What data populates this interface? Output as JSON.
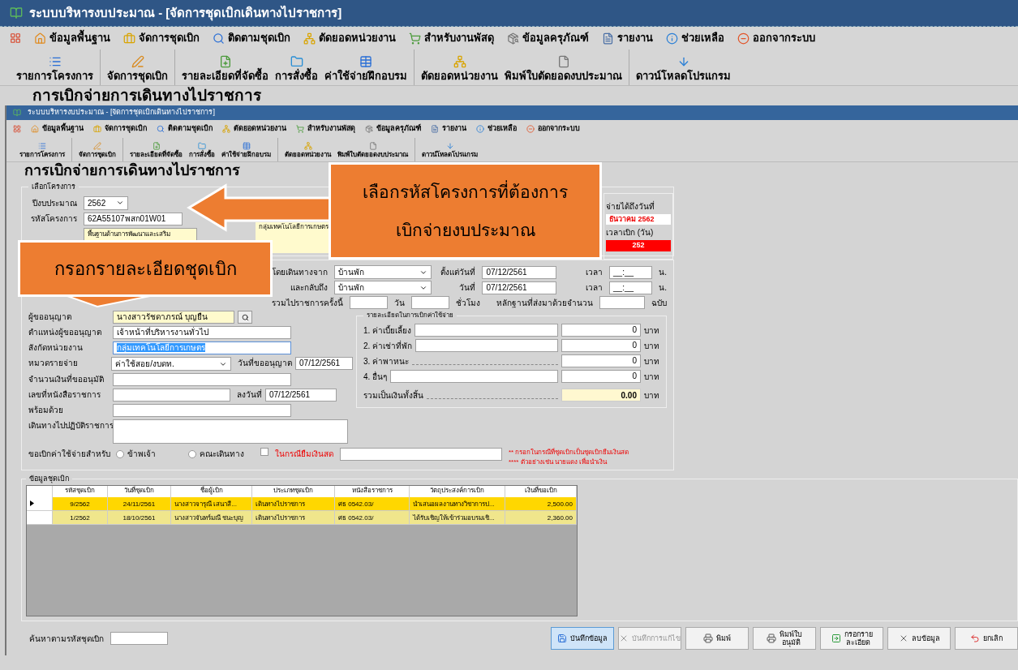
{
  "window": {
    "title": "ระบบบริหารงบประมาณ - [จัดการชุดเบิกเดินทางไปราชการ]"
  },
  "menu": [
    "ข้อมูลพื้นฐาน",
    "จัดการชุดเบิก",
    "ติดตามชุดเบิก",
    "ตัดยอดหน่วยงาน",
    "สำหรับงานพัสดุ",
    "ข้อมูลครุภัณฑ์",
    "รายงาน",
    "ช่วยเหลือ",
    "ออกจากระบบ"
  ],
  "toolbar_groups": [
    {
      "items": [
        "รายการโครงการ"
      ]
    },
    {
      "items": [
        "จัดการชุดเบิก"
      ]
    },
    {
      "items": [
        "รายละเอียดที่จัดซื้อ",
        "การสั่งซื้อ",
        "ค่าใช้จ่ายฝึกอบรม"
      ]
    },
    {
      "items": [
        "ตัดยอดหน่วยงาน",
        "พิมพ์ใบตัดยอดงบประมาณ"
      ]
    },
    {
      "items": [
        "ดาวน์โหลดโปรแกรม"
      ]
    }
  ],
  "page_heading": "การเบิกจ่ายการเดินทางไปราชการ",
  "inner_window": {
    "title": "ระบบบริหารงบประมาณ - [จัดการชุดเบิกเดินทางไปราชการ]",
    "menu": [
      "ข้อมูลพื้นฐาน",
      "จัดการชุดเบิก",
      "ติดตามชุดเบิก",
      "ตัดยอดหน่วยงาน",
      "สำหรับงานพัสดุ",
      "ข้อมูลครุภัณฑ์",
      "รายงาน",
      "ช่วยเหลือ",
      "ออกจากระบบ"
    ],
    "toolbar_groups": [
      {
        "items": [
          "รายการโครงการ"
        ]
      },
      {
        "items": [
          "จัดการชุดเบิก"
        ]
      },
      {
        "items": [
          "รายละเอียดที่จัดซื้อ",
          "การสั่งซื้อ",
          "ค่าใช้จ่ายฝึกอบรม"
        ]
      },
      {
        "items": [
          "ตัดยอดหน่วยงาน",
          "พิมพ์ใบตัดยอดงบประมาณ"
        ]
      },
      {
        "items": [
          "ดาวน์โหลดโปรแกรม"
        ]
      }
    ]
  },
  "form": {
    "heading": "การเบิกจ่ายการเดินทางไปราชการ",
    "project": {
      "legend": "เลือกโครงการ",
      "fiscal_year_label": "ปีงบประมาณ",
      "fiscal_year": "2562",
      "code_label": "รหัสโครงการ",
      "code": "62A55107พสก01W01",
      "output_text": "พื้นฐานด้านการพัฒนาและเสริม",
      "department_note": "กลุ่มเทคโนโลยีการเกษตร",
      "deadline_label": "จ่ายได้ถึงวันที่",
      "deadline": "ธันวาคม 2562",
      "days_label": "เวลาเบิก (วัน)",
      "days": "252"
    },
    "travel": {
      "from_label": "โดยเดินทางจาก",
      "from": "บ้านพัก",
      "start_label": "ตั้งแต่วันที่",
      "start_date": "07/12/2561",
      "start_time_label": "เวลา",
      "start_time": "__:__",
      "start_unit": "น.",
      "return_label": "และกลับถึง",
      "return": "บ้านพัก",
      "return_date_label": "วันที่",
      "return_date": "07/12/2561",
      "return_time_label": "เวลา",
      "return_time": "__:__",
      "return_unit": "น.",
      "total_label": "รวมไปราชการครั้งนี้",
      "days_unit": "วัน",
      "hours_unit": "ชั่วโมง",
      "evidence_label": "หลักฐานที่ส่งมาด้วยจำนวน",
      "evidence_unit": "ฉบับ"
    },
    "fields": [
      {
        "label": "ผู้ขออนุญาต",
        "kind": "lookup",
        "value": "นางสาวรัชดาภรณ์ บุญยืน"
      },
      {
        "label": "ตำแหน่งผู้ขออนุญาต",
        "kind": "text",
        "value": "เจ้าหน้าที่บริหารงานทั่วไป"
      },
      {
        "label": "สังกัดหน่วยงาน",
        "kind": "highlighted",
        "value": "กลุ่มเทคโนโลยีการเกษตร"
      },
      {
        "label": "หมวดรายจ่าย",
        "kind": "select",
        "value": "ค่าใช้สอย/งบดท.",
        "side_label": "วันที่ขออนุญาต",
        "side_value": "07/12/2561"
      },
      {
        "label": "จำนวนเงินที่ขออนุมัติ",
        "kind": "text"
      },
      {
        "label": "เลขที่หนังสือราชการ",
        "kind": "short",
        "side_label": "ลงวันที่",
        "side_value": "07/12/2561"
      },
      {
        "label": "พร้อมด้วย",
        "kind": "text"
      },
      {
        "label": "เดินทางไปปฏิบัติราชการ",
        "kind": "textarea"
      }
    ],
    "claim": {
      "label": "ขอเบิกค่าใช้จ่ายสำหรับ",
      "options": [
        {
          "label": "ข้าพเจ้า",
          "selected": false
        },
        {
          "label": "คณะเดินทาง",
          "selected": false
        }
      ],
      "cash_advance": {
        "label": "ในกรณียืมเงินสด",
        "checked": false
      },
      "notes": [
        "** กรอกในกรณีที่ชุดเบิกเป็นชุดเบิกยืมเงินสด",
        "**** ตัวอย่างเช่น นายแดง เพื่อนำเงิน"
      ]
    },
    "expenses": {
      "legend": "รายละเอียดในการเบิกค่าใช้จ่าย",
      "items": [
        {
          "label": "1. ค่าเบี้ยเลี้ยง",
          "kind": "field",
          "amount": "0",
          "unit": "บาท"
        },
        {
          "label": "2. ค่าเช่าที่พัก",
          "kind": "field",
          "amount": "0",
          "unit": "บาท"
        },
        {
          "label": "3. ค่าพาหนะ",
          "kind": "dotted",
          "amount": "0",
          "unit": "บาท"
        },
        {
          "label": "4. อื่นๆ",
          "kind": "field",
          "amount": "0",
          "unit": "บาท"
        }
      ],
      "total_label": "รวมเป็นเงินทั้งสิ้น",
      "total": "0.00",
      "total_unit": "บาท"
    }
  },
  "grid": {
    "legend": "ข้อมูลชุดเบิก",
    "columns": [
      "รหัสชุดเบิก",
      "วันที่ชุดเบิก",
      "ชื่อผู้เบิก",
      "ประเภทชุดเบิก",
      "หนังสือราชการ",
      "วัตถุประสงค์การเบิก",
      "เงินที่ขอเบิก"
    ],
    "rows": [
      {
        "selected": true,
        "color": "#ffd700",
        "cells": [
          "9/2562",
          "24/11/2561",
          "นางสาวจารุณี เสนาสี...",
          "เดินทางไปราชการ",
          "ศธ 0542.03/",
          "นำเสนอผลงานทางวิชาการป...",
          "2,500.00"
        ]
      },
      {
        "selected": false,
        "color": "#f0e68c",
        "cells": [
          "1/2562",
          "18/10/2561",
          "นางสาวจันทร์มณี ชนะบุญ",
          "เดินทางไปราชการ",
          "ศธ 0542.03/",
          "ได้รับเชิญให้เข้าร่วมอบรมเชิ...",
          "2,360.00"
        ]
      }
    ]
  },
  "bottom": {
    "search_label": "ค้นหาตามรหัสชุดเบิก",
    "buttons": [
      {
        "lines": [
          "บันทึกข้อมูล"
        ],
        "selected": true,
        "disabled": false
      },
      {
        "lines": [
          "บันทึกการแก้ไข"
        ],
        "selected": false,
        "disabled": true
      },
      {
        "lines": [
          "พิมพ์"
        ],
        "selected": false,
        "disabled": false
      },
      {
        "lines": [
          "พิมพ์ใบ",
          "อนุมัติ"
        ],
        "selected": false,
        "disabled": false
      },
      {
        "lines": [
          "กรอกราย",
          "ละเอียด"
        ],
        "selected": false,
        "disabled": false
      },
      {
        "lines": [
          "ลบข้อมูล"
        ],
        "selected": false,
        "disabled": false
      },
      {
        "lines": [
          "ยกเลิก"
        ],
        "selected": false,
        "disabled": false
      }
    ]
  },
  "callouts": [
    {
      "lines": [
        "เลือกรหัสโครงการที่ต้องการ",
        "เบิกจ่ายงบประมาณ"
      ]
    },
    {
      "lines": [
        "กรอกรายละเอียดชุดเบิก"
      ]
    }
  ]
}
